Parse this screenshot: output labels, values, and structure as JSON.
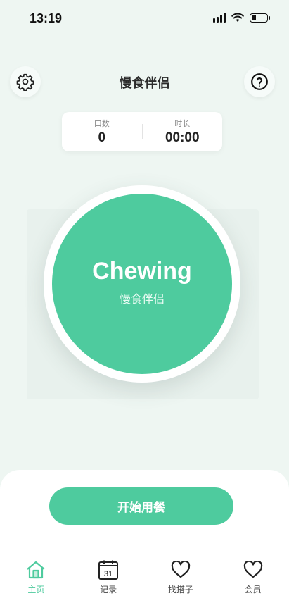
{
  "status_bar": {
    "time": "13:19"
  },
  "header": {
    "title": "慢食伴侣",
    "settings_icon": "gear-icon",
    "help_icon": "question-circle-icon"
  },
  "stats": {
    "bites_label": "口数",
    "bites_value": "0",
    "duration_label": "时长",
    "duration_value": "00:00"
  },
  "main_button": {
    "title": "Chewing",
    "subtitle": "慢食伴侣"
  },
  "start_button_label": "开始用餐",
  "tabs": [
    {
      "label": "主页",
      "icon": "home-icon",
      "active": true
    },
    {
      "label": "记录",
      "icon": "calendar-icon",
      "calendar_day": "31",
      "active": false
    },
    {
      "label": "找搭子",
      "icon": "heart-icon",
      "active": false
    },
    {
      "label": "会员",
      "icon": "heart-icon",
      "active": false
    }
  ],
  "colors": {
    "accent": "#4ecb9e",
    "background": "#eef6f2"
  }
}
